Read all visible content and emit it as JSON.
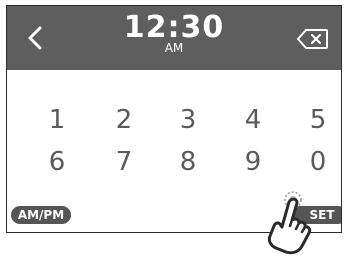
{
  "header": {
    "time": "12:30",
    "period": "AM",
    "back_icon": "chevron-left-icon",
    "delete_icon": "backspace-icon"
  },
  "keypad": {
    "row1": [
      "1",
      "2",
      "3",
      "4",
      "5"
    ],
    "row2": [
      "6",
      "7",
      "8",
      "9",
      "0"
    ]
  },
  "buttons": {
    "ampm_label": "AM/PM",
    "set_label": "SET"
  },
  "colors": {
    "header_bg": "#5e5e5e",
    "digit": "#5a5a5a",
    "pill_bg": "#555555"
  }
}
